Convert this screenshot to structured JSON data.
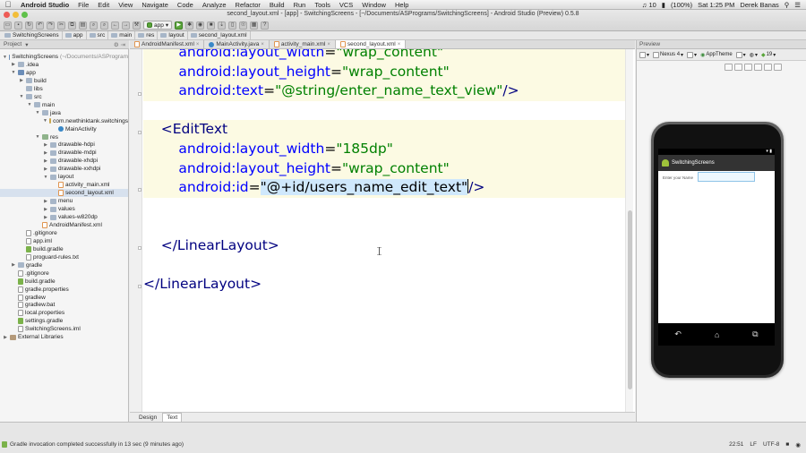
{
  "menubar": {
    "app_name": "Android Studio",
    "items": [
      "File",
      "Edit",
      "View",
      "Navigate",
      "Code",
      "Analyze",
      "Refactor",
      "Build",
      "Run",
      "Tools",
      "VCS",
      "Window",
      "Help"
    ],
    "battery": "(100%)",
    "clock": "Sat 1:25 PM",
    "user": "Derek Banas",
    "volume_num": "10"
  },
  "window": {
    "title": "second_layout.xml - [app] - SwitchingScreens - [~/Documents/ASPrograms/SwitchingScreens] - Android Studio (Preview) 0.5.8"
  },
  "toolbar": {
    "run_config": "app"
  },
  "breadcrumb": [
    "SwitchingScreens",
    "app",
    "src",
    "main",
    "res",
    "layout",
    "second_layout.xml"
  ],
  "project_panel": {
    "header": "Project",
    "tree": [
      {
        "label": "SwitchingScreens",
        "extra": "(~/Documents/ASProgram",
        "indent": 0,
        "icon": "mod",
        "arrow": "▼"
      },
      {
        "label": ".idea",
        "indent": 1,
        "icon": "folder",
        "arrow": "▶"
      },
      {
        "label": "app",
        "indent": 1,
        "icon": "mod",
        "arrow": "▼"
      },
      {
        "label": "build",
        "indent": 2,
        "icon": "folder",
        "arrow": "▶"
      },
      {
        "label": "libs",
        "indent": 2,
        "icon": "folder",
        "arrow": ""
      },
      {
        "label": "src",
        "indent": 2,
        "icon": "folder",
        "arrow": "▼"
      },
      {
        "label": "main",
        "indent": 3,
        "icon": "folder",
        "arrow": "▼"
      },
      {
        "label": "java",
        "indent": 4,
        "icon": "folder",
        "arrow": "▼"
      },
      {
        "label": "com.newthinktank.switchings",
        "indent": 5,
        "icon": "pkg",
        "arrow": "▼"
      },
      {
        "label": "MainActivity",
        "indent": 6,
        "icon": "cls",
        "arrow": ""
      },
      {
        "label": "res",
        "indent": 4,
        "icon": "res",
        "arrow": "▼"
      },
      {
        "label": "drawable-hdpi",
        "indent": 5,
        "icon": "folder",
        "arrow": "▶"
      },
      {
        "label": "drawable-mdpi",
        "indent": 5,
        "icon": "folder",
        "arrow": "▶"
      },
      {
        "label": "drawable-xhdpi",
        "indent": 5,
        "icon": "folder",
        "arrow": "▶"
      },
      {
        "label": "drawable-xxhdpi",
        "indent": 5,
        "icon": "folder",
        "arrow": "▶"
      },
      {
        "label": "layout",
        "indent": 5,
        "icon": "folder",
        "arrow": "▼"
      },
      {
        "label": "activity_main.xml",
        "indent": 6,
        "icon": "xml",
        "arrow": ""
      },
      {
        "label": "second_layout.xml",
        "indent": 6,
        "icon": "xml",
        "arrow": "",
        "selected": true
      },
      {
        "label": "menu",
        "indent": 5,
        "icon": "folder",
        "arrow": "▶"
      },
      {
        "label": "values",
        "indent": 5,
        "icon": "folder",
        "arrow": "▶"
      },
      {
        "label": "values-w820dp",
        "indent": 5,
        "icon": "folder",
        "arrow": "▶"
      },
      {
        "label": "AndroidManifest.xml",
        "indent": 4,
        "icon": "xml",
        "arrow": ""
      },
      {
        "label": ".gitignore",
        "indent": 2,
        "icon": "file",
        "arrow": ""
      },
      {
        "label": "app.iml",
        "indent": 2,
        "icon": "file",
        "arrow": ""
      },
      {
        "label": "build.gradle",
        "indent": 2,
        "icon": "grd",
        "arrow": ""
      },
      {
        "label": "proguard-rules.txt",
        "indent": 2,
        "icon": "file",
        "arrow": ""
      },
      {
        "label": "gradle",
        "indent": 1,
        "icon": "folder",
        "arrow": "▶"
      },
      {
        "label": ".gitignore",
        "indent": 1,
        "icon": "file",
        "arrow": ""
      },
      {
        "label": "build.gradle",
        "indent": 1,
        "icon": "grd",
        "arrow": ""
      },
      {
        "label": "gradle.properties",
        "indent": 1,
        "icon": "file",
        "arrow": ""
      },
      {
        "label": "gradlew",
        "indent": 1,
        "icon": "file",
        "arrow": ""
      },
      {
        "label": "gradlew.bat",
        "indent": 1,
        "icon": "file",
        "arrow": ""
      },
      {
        "label": "local.properties",
        "indent": 1,
        "icon": "file",
        "arrow": ""
      },
      {
        "label": "settings.gradle",
        "indent": 1,
        "icon": "grd",
        "arrow": ""
      },
      {
        "label": "SwitchingScreens.iml",
        "indent": 1,
        "icon": "file",
        "arrow": ""
      },
      {
        "label": "External Libraries",
        "indent": 0,
        "icon": "lib",
        "arrow": "▶"
      }
    ]
  },
  "editor_tabs": [
    {
      "label": "AndroidManifest.xml",
      "active": false
    },
    {
      "label": "MainActivity.java",
      "active": false
    },
    {
      "label": "activity_main.xml",
      "active": false
    },
    {
      "label": "second_layout.xml",
      "active": true
    }
  ],
  "code": [
    {
      "indent": "        ",
      "parts": [
        [
          "attr",
          "android:layout_width"
        ],
        [
          "plain",
          "="
        ],
        [
          "val",
          "\"wrap_content\""
        ]
      ]
    },
    {
      "indent": "        ",
      "parts": [
        [
          "attr",
          "android:layout_height"
        ],
        [
          "plain",
          "="
        ],
        [
          "val",
          "\"wrap_content\""
        ]
      ]
    },
    {
      "indent": "        ",
      "parts": [
        [
          "attr",
          "android:text"
        ],
        [
          "plain",
          "="
        ],
        [
          "val",
          "\"@string/enter_name_text_view\""
        ],
        [
          "tag",
          "/>"
        ]
      ]
    },
    {
      "indent": "",
      "parts": []
    },
    {
      "indent": "    ",
      "parts": [
        [
          "tag",
          "<EditText"
        ]
      ]
    },
    {
      "indent": "        ",
      "parts": [
        [
          "attr",
          "android:layout_width"
        ],
        [
          "plain",
          "="
        ],
        [
          "val",
          "\"185dp\""
        ]
      ]
    },
    {
      "indent": "        ",
      "parts": [
        [
          "attr",
          "android:layout_height"
        ],
        [
          "plain",
          "="
        ],
        [
          "val",
          "\"wrap_content\""
        ]
      ]
    },
    {
      "indent": "        ",
      "parts": [
        [
          "attr",
          "android:id"
        ],
        [
          "plain",
          "="
        ],
        [
          "idval",
          "\"@+id/users_name_edit_text\""
        ],
        [
          "caret",
          ""
        ],
        [
          "tag",
          "/>"
        ]
      ],
      "current": true
    },
    {
      "indent": "",
      "parts": []
    },
    {
      "indent": "",
      "parts": []
    },
    {
      "indent": "    ",
      "parts": [
        [
          "tag",
          "</LinearLayout>"
        ]
      ]
    },
    {
      "indent": "",
      "parts": []
    },
    {
      "indent": "",
      "parts": [
        [
          "tag",
          "</LinearLayout>"
        ]
      ]
    }
  ],
  "editor_bottom_tabs": [
    "Design",
    "Text"
  ],
  "preview": {
    "header": "Preview",
    "device": "Nexus 4",
    "theme": "AppTheme",
    "api": "19",
    "app_title": "SwitchingScreens",
    "label_text": "Enter your Name"
  },
  "status": {
    "message": "Gradle invocation completed successfully in 13 sec (9 minutes ago)",
    "position": "22:51",
    "line_sep": "LF",
    "encoding": "UTF-8"
  }
}
